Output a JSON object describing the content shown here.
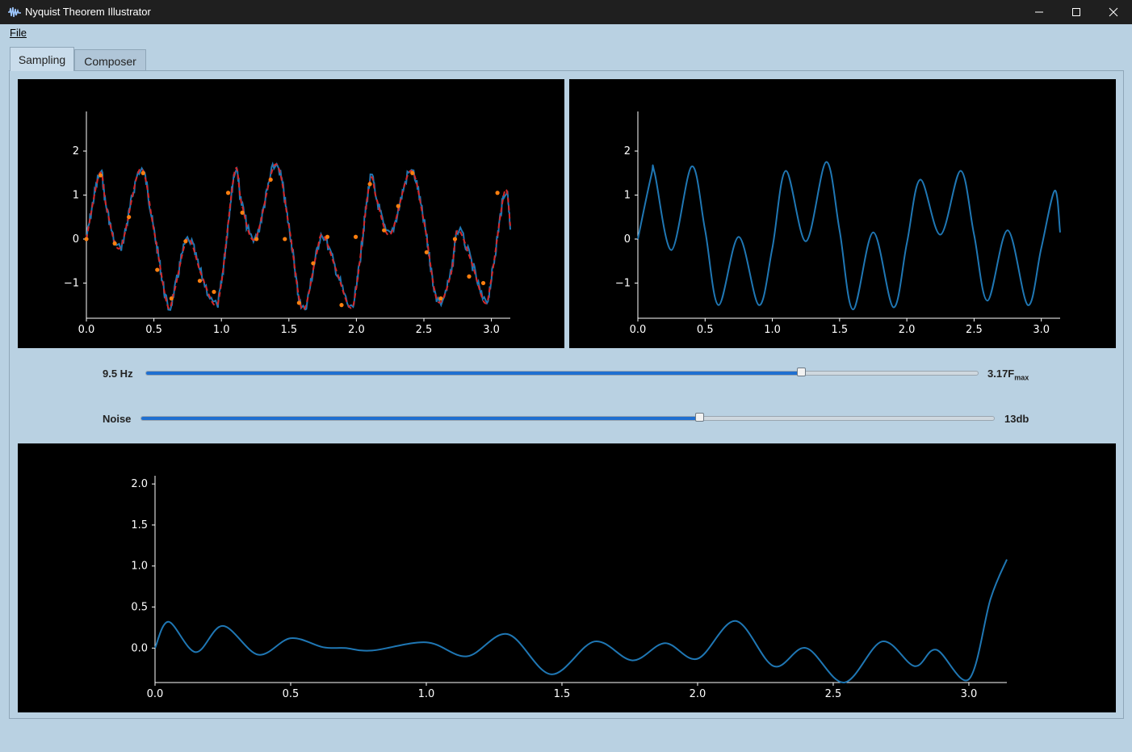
{
  "window": {
    "title": "Nyquist Theorem Illustrator",
    "controls": [
      "minimize-icon",
      "maximize-icon",
      "close-icon"
    ]
  },
  "menu": {
    "file": "File"
  },
  "tabs": [
    {
      "label": "Sampling",
      "selected": true
    },
    {
      "label": "Composer",
      "selected": false
    }
  ],
  "colors": {
    "signal": "#1f77b4",
    "reconstruction": "#d62728",
    "samples": "#ff7f0e",
    "slider_fill": "#1f6fd0"
  },
  "sliders": {
    "frequency": {
      "label": "9.5 Hz",
      "value_main": "3.17F",
      "value_sub": "max",
      "fraction": 0.788
    },
    "noise": {
      "label": "Noise",
      "value": "13db",
      "fraction": 0.655
    }
  },
  "chart_data": [
    {
      "type": "line",
      "xlim": [
        0,
        3.14
      ],
      "ylim": [
        -1.8,
        2.9
      ],
      "xticks": [
        "0.0",
        "0.5",
        "1.0",
        "1.5",
        "2.0",
        "2.5",
        "3.0"
      ],
      "yticks": [
        "−1",
        "0",
        "1",
        "2"
      ],
      "series": [
        {
          "style": "noisy-solid",
          "color": "#1f77b4",
          "x": [
            0,
            0.1,
            0.15,
            0.25,
            0.4,
            0.5,
            0.6,
            0.65,
            0.75,
            0.85,
            0.95,
            1.0,
            1.1,
            1.15,
            1.25,
            1.4,
            1.5,
            1.6,
            1.7,
            1.75,
            1.85,
            1.95,
            2.0,
            2.1,
            2.15,
            2.25,
            2.4,
            2.5,
            2.6,
            2.7,
            2.75,
            2.85,
            2.95,
            3.0,
            3.1,
            3.14
          ],
          "y": [
            0,
            1.5,
            0.7,
            -0.2,
            1.6,
            0.2,
            -1.5,
            -1.2,
            0,
            -0.8,
            -1.5,
            -1.0,
            1.55,
            0.8,
            0,
            1.7,
            0.3,
            -1.6,
            -0.4,
            0.1,
            -0.7,
            -1.55,
            -1.1,
            1.3,
            0.9,
            0.1,
            1.55,
            0.4,
            -1.4,
            -0.8,
            0.2,
            -0.5,
            -1.45,
            -0.9,
            1.1,
            0.3
          ]
        },
        {
          "style": "dashed",
          "color": "#d62728",
          "x": [
            0,
            0.1,
            0.15,
            0.25,
            0.4,
            0.5,
            0.6,
            0.65,
            0.75,
            0.85,
            0.95,
            1.0,
            1.1,
            1.15,
            1.25,
            1.4,
            1.5,
            1.6,
            1.7,
            1.75,
            1.85,
            1.95,
            2.0,
            2.1,
            2.15,
            2.25,
            2.4,
            2.5,
            2.6,
            2.7,
            2.75,
            2.85,
            2.95,
            3.0,
            3.1,
            3.14
          ],
          "y": [
            0,
            1.5,
            0.7,
            -0.2,
            1.6,
            0.2,
            -1.5,
            -1.2,
            0,
            -0.8,
            -1.5,
            -1.0,
            1.55,
            0.8,
            0,
            1.7,
            0.3,
            -1.6,
            -0.4,
            0.1,
            -0.7,
            -1.55,
            -1.1,
            1.3,
            0.9,
            0.1,
            1.55,
            0.4,
            -1.4,
            -0.8,
            0.2,
            -0.5,
            -1.45,
            -0.9,
            1.1,
            0.3
          ]
        },
        {
          "style": "points",
          "color": "#ff7f0e",
          "x": [
            0,
            0.105,
            0.21,
            0.315,
            0.42,
            0.525,
            0.63,
            0.735,
            0.84,
            0.945,
            1.05,
            1.155,
            1.26,
            1.365,
            1.47,
            1.575,
            1.68,
            1.785,
            1.89,
            1.995,
            2.1,
            2.205,
            2.31,
            2.415,
            2.52,
            2.625,
            2.73,
            2.835,
            2.94,
            3.045
          ],
          "y": [
            0,
            1.45,
            -0.1,
            0.5,
            1.5,
            -0.7,
            -1.35,
            -0.05,
            -0.95,
            -1.2,
            1.05,
            0.6,
            0.0,
            1.35,
            0.0,
            -1.45,
            -0.55,
            0.05,
            -1.5,
            0.05,
            1.25,
            0.2,
            0.75,
            1.5,
            -0.3,
            -1.35,
            0.0,
            -0.85,
            -1.0,
            1.05
          ]
        }
      ]
    },
    {
      "type": "line",
      "xlim": [
        0,
        3.14
      ],
      "ylim": [
        -1.8,
        2.9
      ],
      "xticks": [
        "0.0",
        "0.5",
        "1.0",
        "1.5",
        "2.0",
        "2.5",
        "3.0"
      ],
      "yticks": [
        "−1",
        "0",
        "1",
        "2"
      ],
      "series": [
        {
          "color": "#1f77b4",
          "x": [
            0,
            0.1,
            0.125,
            0.25,
            0.4,
            0.5,
            0.6,
            0.75,
            0.9,
            1.0,
            1.1,
            1.25,
            1.4,
            1.5,
            1.6,
            1.75,
            1.9,
            2.0,
            2.1,
            2.25,
            2.4,
            2.5,
            2.6,
            2.75,
            2.9,
            3.0,
            3.1,
            3.14
          ],
          "y": [
            0,
            1.45,
            1.5,
            -0.25,
            1.65,
            0.2,
            -1.5,
            0.05,
            -1.5,
            -0.2,
            1.55,
            -0.05,
            1.75,
            0.2,
            -1.6,
            0.15,
            -1.55,
            -0.1,
            1.35,
            0.1,
            1.55,
            0.1,
            -1.4,
            0.2,
            -1.5,
            -0.2,
            1.1,
            0.15
          ]
        }
      ]
    },
    {
      "type": "line",
      "xlim": [
        0,
        3.14
      ],
      "ylim": [
        -0.42,
        2.1
      ],
      "xticks": [
        "0.0",
        "0.5",
        "1.0",
        "1.5",
        "2.0",
        "2.5",
        "3.0"
      ],
      "yticks": [
        "0.0",
        "0.5",
        "1.0",
        "1.5",
        "2.0"
      ],
      "series": [
        {
          "color": "#1f77b4",
          "x": [
            0,
            0.05,
            0.15,
            0.25,
            0.38,
            0.5,
            0.62,
            0.7,
            0.8,
            1.0,
            1.15,
            1.3,
            1.46,
            1.62,
            1.76,
            1.88,
            2.0,
            2.14,
            2.28,
            2.4,
            2.54,
            2.68,
            2.8,
            2.88,
            3.0,
            3.08,
            3.14
          ],
          "y": [
            0,
            0.32,
            -0.05,
            0.27,
            -0.08,
            0.12,
            0.01,
            0.0,
            -0.03,
            0.07,
            -0.1,
            0.17,
            -0.32,
            0.08,
            -0.15,
            0.06,
            -0.13,
            0.33,
            -0.22,
            0.0,
            -0.42,
            0.08,
            -0.22,
            -0.02,
            -0.38,
            0.6,
            1.08
          ]
        }
      ]
    }
  ]
}
